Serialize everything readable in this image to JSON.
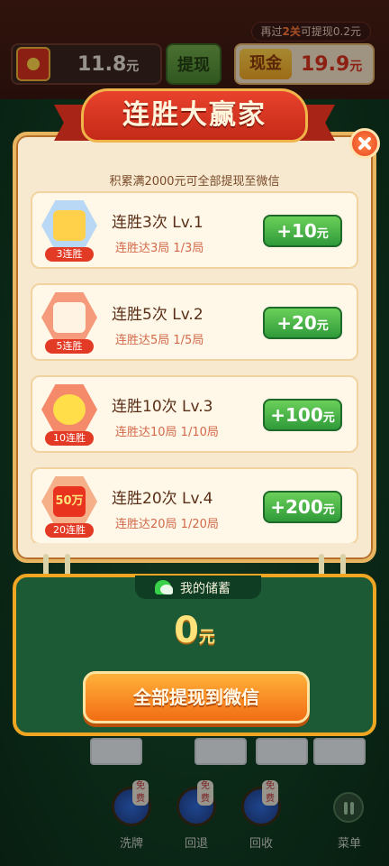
{
  "hud": {
    "tip_prefix": "再过",
    "tip_highlight": "2关",
    "tip_suffix": "可提现0.2元",
    "wallet_amount": "11.8",
    "wallet_unit": "元",
    "withdraw_label": "提现",
    "cash_label": "现金",
    "cash_amount": "19.9",
    "cash_unit": "元"
  },
  "popup": {
    "title": "连胜大赢家",
    "subtitle": "积累满2000元可全部提现至微信",
    "tasks": [
      {
        "title": "连胜3次 Lv.1",
        "progress": "连胜达3局 1/3局",
        "reward": "+10",
        "unit": "元",
        "badge": "3连胜",
        "badge_icon": "gift-box-icon"
      },
      {
        "title": "连胜5次 Lv.2",
        "progress": "连胜达5局 1/5局",
        "reward": "+20",
        "unit": "元",
        "badge": "5连胜",
        "badge_icon": "calendar-icon"
      },
      {
        "title": "连胜10次 Lv.3",
        "progress": "连胜达10局 1/10局",
        "reward": "+100",
        "unit": "元",
        "badge": "10连胜",
        "badge_icon": "chick-icon"
      },
      {
        "title": "连胜20次 Lv.4",
        "progress": "连胜达20局 1/20局",
        "reward": "+200",
        "unit": "元",
        "badge": "20连胜",
        "badge_icon": "red-envelope-icon",
        "badge_text": "50万"
      }
    ]
  },
  "savings": {
    "title": "我的储蓄",
    "amount": "0",
    "unit": "元",
    "button": "全部提现到微信"
  },
  "toolbar": {
    "items": [
      {
        "label": "洗牌",
        "badge": "免费"
      },
      {
        "label": "回退",
        "badge": "免费"
      },
      {
        "label": "回收",
        "badge": "免费"
      }
    ],
    "menu_label": "菜单"
  }
}
